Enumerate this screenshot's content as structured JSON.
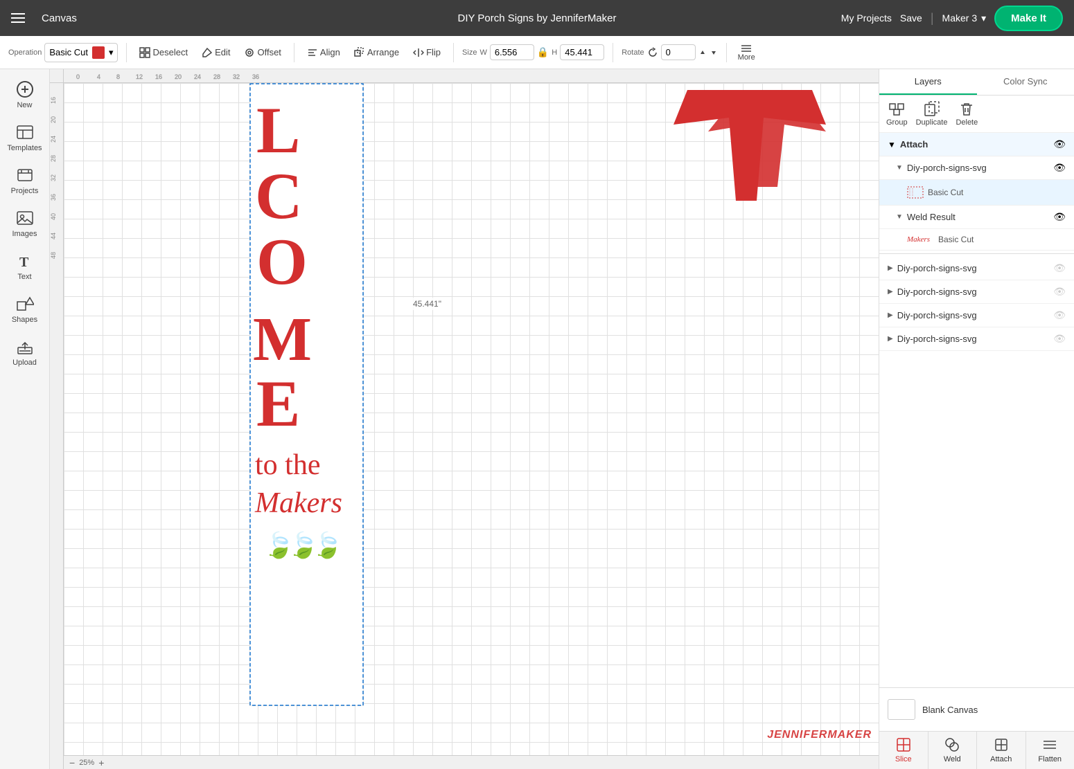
{
  "app": {
    "title": "Canvas",
    "project_title": "DIY Porch Signs by JenniferMaker",
    "my_projects": "My Projects",
    "save": "Save",
    "machine": "Maker 3",
    "make_it": "Make It"
  },
  "toolbar": {
    "operation_label": "Operation",
    "operation_value": "Basic Cut",
    "deselect": "Deselect",
    "edit": "Edit",
    "offset": "Offset",
    "align": "Align",
    "arrange": "Arrange",
    "flip": "Flip",
    "size_label": "Size",
    "width_label": "W",
    "width_value": "6.556",
    "height_label": "H",
    "height_value": "45.441",
    "rotate_label": "Rotate",
    "rotate_value": "0",
    "more": "More"
  },
  "sidebar": {
    "items": [
      {
        "label": "New",
        "icon": "plus-icon"
      },
      {
        "label": "Templates",
        "icon": "templates-icon"
      },
      {
        "label": "Projects",
        "icon": "projects-icon"
      },
      {
        "label": "Images",
        "icon": "images-icon"
      },
      {
        "label": "Text",
        "icon": "text-icon"
      },
      {
        "label": "Shapes",
        "icon": "shapes-icon"
      },
      {
        "label": "Upload",
        "icon": "upload-icon"
      }
    ]
  },
  "canvas": {
    "zoom": "25%",
    "dimension_label": "45.441\""
  },
  "right_panel": {
    "tabs": [
      {
        "label": "Layers",
        "active": true
      },
      {
        "label": "Color Sync",
        "active": false
      }
    ],
    "toolbar_items": [
      {
        "label": "Group",
        "icon": "group-icon"
      },
      {
        "label": "Duplicate",
        "icon": "duplicate-icon"
      },
      {
        "label": "Delete",
        "icon": "delete-icon"
      }
    ],
    "layers": [
      {
        "id": "attach-1",
        "type": "attach-header",
        "label": "Attach",
        "expanded": true,
        "visible": true,
        "children": [
          {
            "id": "diy-1",
            "label": "Diy-porch-signs-svg",
            "expanded": true,
            "visible": true,
            "children": [
              {
                "id": "basic-cut-1",
                "label": "Basic Cut",
                "type": "cut",
                "color": "#d32f2f"
              }
            ]
          },
          {
            "id": "weld-1",
            "label": "Weld Result",
            "expanded": true,
            "visible": true,
            "children": [
              {
                "id": "basic-cut-2",
                "label": "Basic Cut",
                "type": "cut-makers",
                "color": "#d32f2f"
              }
            ]
          }
        ]
      },
      {
        "id": "diy-2",
        "label": "Diy-porch-signs-svg",
        "expanded": false,
        "visible": false
      },
      {
        "id": "diy-3",
        "label": "Diy-porch-signs-svg",
        "expanded": false,
        "visible": false
      },
      {
        "id": "diy-4",
        "label": "Diy-porch-signs-svg",
        "expanded": false,
        "visible": false
      },
      {
        "id": "diy-5",
        "label": "Diy-porch-signs-svg",
        "expanded": false,
        "visible": false
      }
    ],
    "blank_canvas_label": "Blank Canvas",
    "bottom_actions": [
      {
        "label": "Slice",
        "icon": "slice-icon"
      },
      {
        "label": "Weld",
        "icon": "weld-icon"
      },
      {
        "label": "Attach",
        "icon": "attach-icon"
      },
      {
        "label": "Flatten",
        "icon": "flatten-icon"
      }
    ]
  },
  "watermark": "JENNIFERMAKER"
}
